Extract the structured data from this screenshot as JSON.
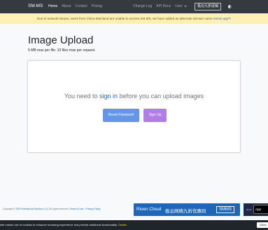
{
  "navbar": {
    "brand": "SM.MS",
    "links": [
      "Home",
      "About",
      "Contact",
      "Pricing"
    ],
    "right_links": [
      "Change Log",
      "API Docs"
    ],
    "user_label": "User",
    "promo_button": "极云九折促销"
  },
  "alert": {
    "text": "Due to network issues, users from China Mainland are unable to access SM.MS, we have added an alternate domain name",
    "link": "smms.app"
  },
  "heading": {
    "title": "Image Upload",
    "subtitle": "5 MB max per file. 10 files max per request."
  },
  "upload_card": {
    "msg_before": "You need to ",
    "msg_link": "sign in",
    "msg_after": " before you can upload images",
    "reset_label": "Reset Password",
    "signup_label": "Sign Up"
  },
  "footer": {
    "copy_prefix": "Copyright ©",
    "company": "SM Professional Services, LLC",
    "rights": " All rights reserved.",
    "terms": "Terms of Use",
    "separator": " - ",
    "privacy": "Privacy Policy"
  },
  "promo": {
    "brand": "Riven Cloud",
    "text": "极云网络九折优惠码",
    "code": "SMMS",
    "dark_text": "dow",
    "app_store": "App"
  },
  "cookie": {
    "text": "site makes use of cookies to enhance browsing experience and provide additional functionality.",
    "details": "Details",
    "allow": "Allow"
  }
}
